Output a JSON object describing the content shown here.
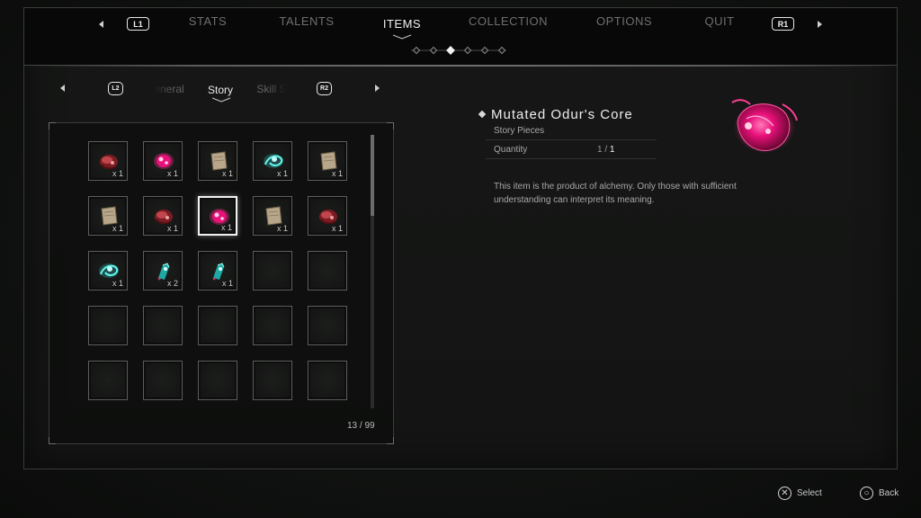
{
  "colors": {
    "accent": "#f0f0f0",
    "core_pink": "#ff2d8a",
    "teal": "#33d6d0"
  },
  "top_tabs": {
    "left_button": "L1",
    "right_button": "R1",
    "items": [
      {
        "label": "STATS",
        "active": false
      },
      {
        "label": "TALENTS",
        "active": false
      },
      {
        "label": "ITEMS",
        "active": true
      },
      {
        "label": "COLLECTION",
        "active": false
      },
      {
        "label": "OPTIONS",
        "active": false
      },
      {
        "label": "QUIT",
        "active": false
      }
    ],
    "page_dots": 6,
    "active_dot": 2
  },
  "sub_tabs": {
    "left_button": "L2",
    "right_button": "R2",
    "items": [
      {
        "label": "eneral",
        "active": false
      },
      {
        "label": "Story",
        "active": true
      },
      {
        "label": "Skill S",
        "active": false
      }
    ]
  },
  "inventory": {
    "count": "13 / 99",
    "slots": [
      {
        "icon": "meat-core-icon",
        "qty": "x 1"
      },
      {
        "icon": "pink-core-icon",
        "qty": "x 1"
      },
      {
        "icon": "parchment-icon",
        "qty": "x 1"
      },
      {
        "icon": "teal-swirl-icon",
        "qty": "x 1"
      },
      {
        "icon": "parchment-icon",
        "qty": "x 1"
      },
      {
        "icon": "parchment-icon",
        "qty": "x 1"
      },
      {
        "icon": "meat-core-icon",
        "qty": "x 1"
      },
      {
        "icon": "pink-core-icon",
        "qty": "x 1",
        "selected": true
      },
      {
        "icon": "parchment-icon",
        "qty": "x 1"
      },
      {
        "icon": "meat-core-icon",
        "qty": "x 1"
      },
      {
        "icon": "teal-swirl-icon",
        "qty": "x 1"
      },
      {
        "icon": "teal-crystal-icon",
        "qty": "x 2"
      },
      {
        "icon": "teal-crystal-icon",
        "qty": "x 1"
      },
      {
        "icon": "",
        "qty": ""
      },
      {
        "icon": "",
        "qty": ""
      },
      {
        "icon": "",
        "qty": ""
      },
      {
        "icon": "",
        "qty": ""
      },
      {
        "icon": "",
        "qty": ""
      },
      {
        "icon": "",
        "qty": ""
      },
      {
        "icon": "",
        "qty": ""
      },
      {
        "icon": "",
        "qty": ""
      },
      {
        "icon": "",
        "qty": ""
      },
      {
        "icon": "",
        "qty": ""
      },
      {
        "icon": "",
        "qty": ""
      },
      {
        "icon": "",
        "qty": ""
      }
    ]
  },
  "detail": {
    "title": "Mutated Odur's Core",
    "category": "Story Pieces",
    "quantity_label": "Quantity",
    "quantity_current": "1",
    "quantity_sep": " / ",
    "quantity_max": "1",
    "description": "This item is the product of alchemy. Only those with sufficient understanding can interpret its meaning.",
    "icon": "mutated-core-icon"
  },
  "footer": {
    "select_label": "Select",
    "back_label": "Back"
  }
}
